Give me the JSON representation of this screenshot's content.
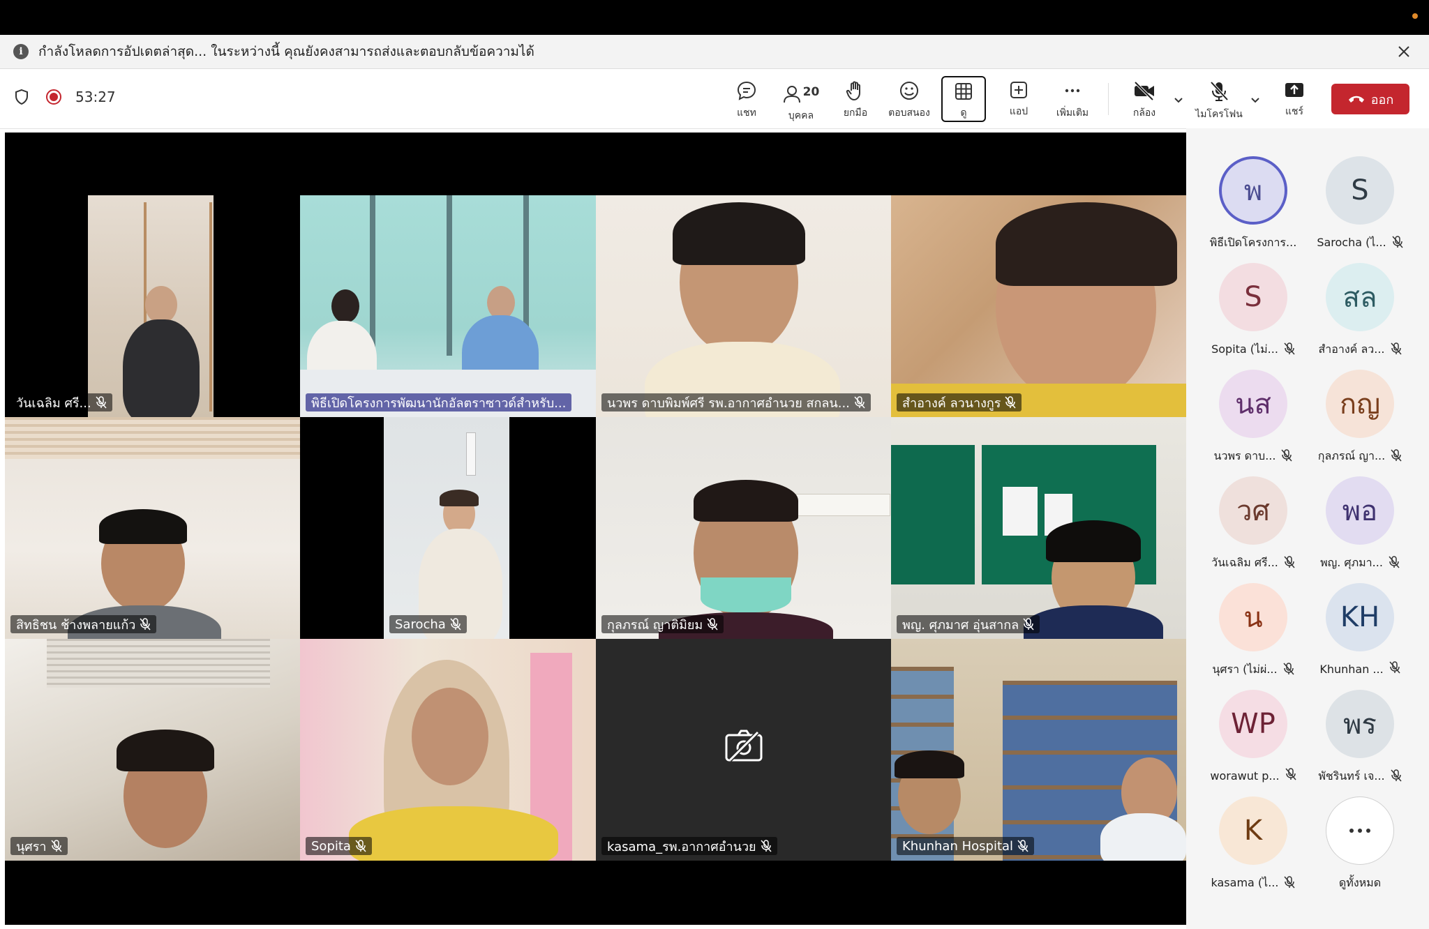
{
  "banner": {
    "message": "กำลังโหลดการอัปเดตล่าสุด... ในระหว่างนี้ คุณยังคงสามารถส่งและตอบกลับข้อความได้",
    "info_icon": "info-icon",
    "close_icon": "close-icon"
  },
  "meeting": {
    "timer": "53:27",
    "shield_icon": "shield-icon",
    "recording_icon": "recording-icon"
  },
  "toolbar": {
    "chat": "แชท",
    "people": "บุคคล",
    "people_count": "20",
    "raise_hand": "ยกมือ",
    "react": "ตอบสนอง",
    "view": "ดู",
    "apps": "แอป",
    "more": "เพิ่มเติม",
    "camera": "กล้อง",
    "mic": "ไมโครโฟน",
    "share": "แชร์",
    "leave": "ออก",
    "leave_color": "#c4262e"
  },
  "tiles": [
    {
      "name": "วันเฉลิม ศรี...",
      "muted": true,
      "highlight": false
    },
    {
      "name": "พิธีเปิดโครงการพัฒนานักอัลตราซาวด์สำหรับ...",
      "muted": false,
      "highlight": true
    },
    {
      "name": "นวพร ดาบพิมพ์ศรี รพ.อากาศอำนวย สกลน...",
      "muted": true,
      "highlight": false
    },
    {
      "name": "สำอางค์ ลวนางกูร",
      "muted": true,
      "highlight": false
    },
    {
      "name": "สิทธิชน ช้างพลายแก้ว",
      "muted": true,
      "highlight": false
    },
    {
      "name": "Sarocha",
      "muted": true,
      "highlight": false
    },
    {
      "name": "กุลภรณ์ ญาติมิยม",
      "muted": true,
      "highlight": false
    },
    {
      "name": "พญ. ศุภมาศ อุ่นสากล",
      "muted": true,
      "highlight": false
    },
    {
      "name": "นุศรา",
      "muted": true,
      "highlight": false
    },
    {
      "name": "Sopita",
      "muted": true,
      "highlight": false
    },
    {
      "name": "kasama_รพ.อากาศอำนวย",
      "muted": true,
      "highlight": false
    },
    {
      "name": "Khunhan Hospital",
      "muted": true,
      "highlight": false
    }
  ],
  "participants": [
    {
      "initials": "พ",
      "name": "พิธีเปิดโครงการ...",
      "muted": false,
      "bg": "#dcdcf2",
      "fg": "#4b4c91",
      "speaking": true
    },
    {
      "initials": "S",
      "name": "Sarocha (ไ...",
      "muted": true,
      "bg": "#dde3e8",
      "fg": "#2f3b45",
      "speaking": false
    },
    {
      "initials": "S",
      "name": "Sopita (ไม่...",
      "muted": true,
      "bg": "#f3dde1",
      "fg": "#7a2f3c",
      "speaking": false
    },
    {
      "initials": "สล",
      "name": "สำอางค์ ลว...",
      "muted": true,
      "bg": "#dceef0",
      "fg": "#2d5b62",
      "speaking": false
    },
    {
      "initials": "นส",
      "name": "นวพร ดาบ...",
      "muted": true,
      "bg": "#ecdcef",
      "fg": "#5f2f6b",
      "speaking": false
    },
    {
      "initials": "กญ",
      "name": "กุลภรณ์ ญา...",
      "muted": true,
      "bg": "#f6e3d8",
      "fg": "#7a3f1d",
      "speaking": false
    },
    {
      "initials": "วศ",
      "name": "วันเฉลิม ศรี...",
      "muted": true,
      "bg": "#efe0dc",
      "fg": "#6b3a2e",
      "speaking": false
    },
    {
      "initials": "พอ",
      "name": "พญ. ศุภมา...",
      "muted": true,
      "bg": "#e2dcf1",
      "fg": "#3f3270",
      "speaking": false
    },
    {
      "initials": "น",
      "name": "นุศรา (ไม่ผ่...",
      "muted": true,
      "bg": "#fbe1d8",
      "fg": "#8a3215",
      "speaking": false
    },
    {
      "initials": "KH",
      "name": "Khunhan ...",
      "muted": true,
      "bg": "#dbe3ee",
      "fg": "#1f3d66",
      "speaking": false
    },
    {
      "initials": "WP",
      "name": "worawut p...",
      "muted": true,
      "bg": "#f5dde4",
      "fg": "#6d2235",
      "speaking": false
    },
    {
      "initials": "พร",
      "name": "พัชรินทร์ เจ...",
      "muted": true,
      "bg": "#dde2e6",
      "fg": "#2f3a44",
      "speaking": false
    },
    {
      "initials": "K",
      "name": "kasama (ไ...",
      "muted": true,
      "bg": "#f8e7d6",
      "fg": "#6e3b12",
      "speaking": false
    },
    {
      "initials": "…",
      "name": "ดูทั้งหมด",
      "muted": false,
      "bg": "#ffffff",
      "fg": "#333333",
      "speaking": false
    }
  ]
}
